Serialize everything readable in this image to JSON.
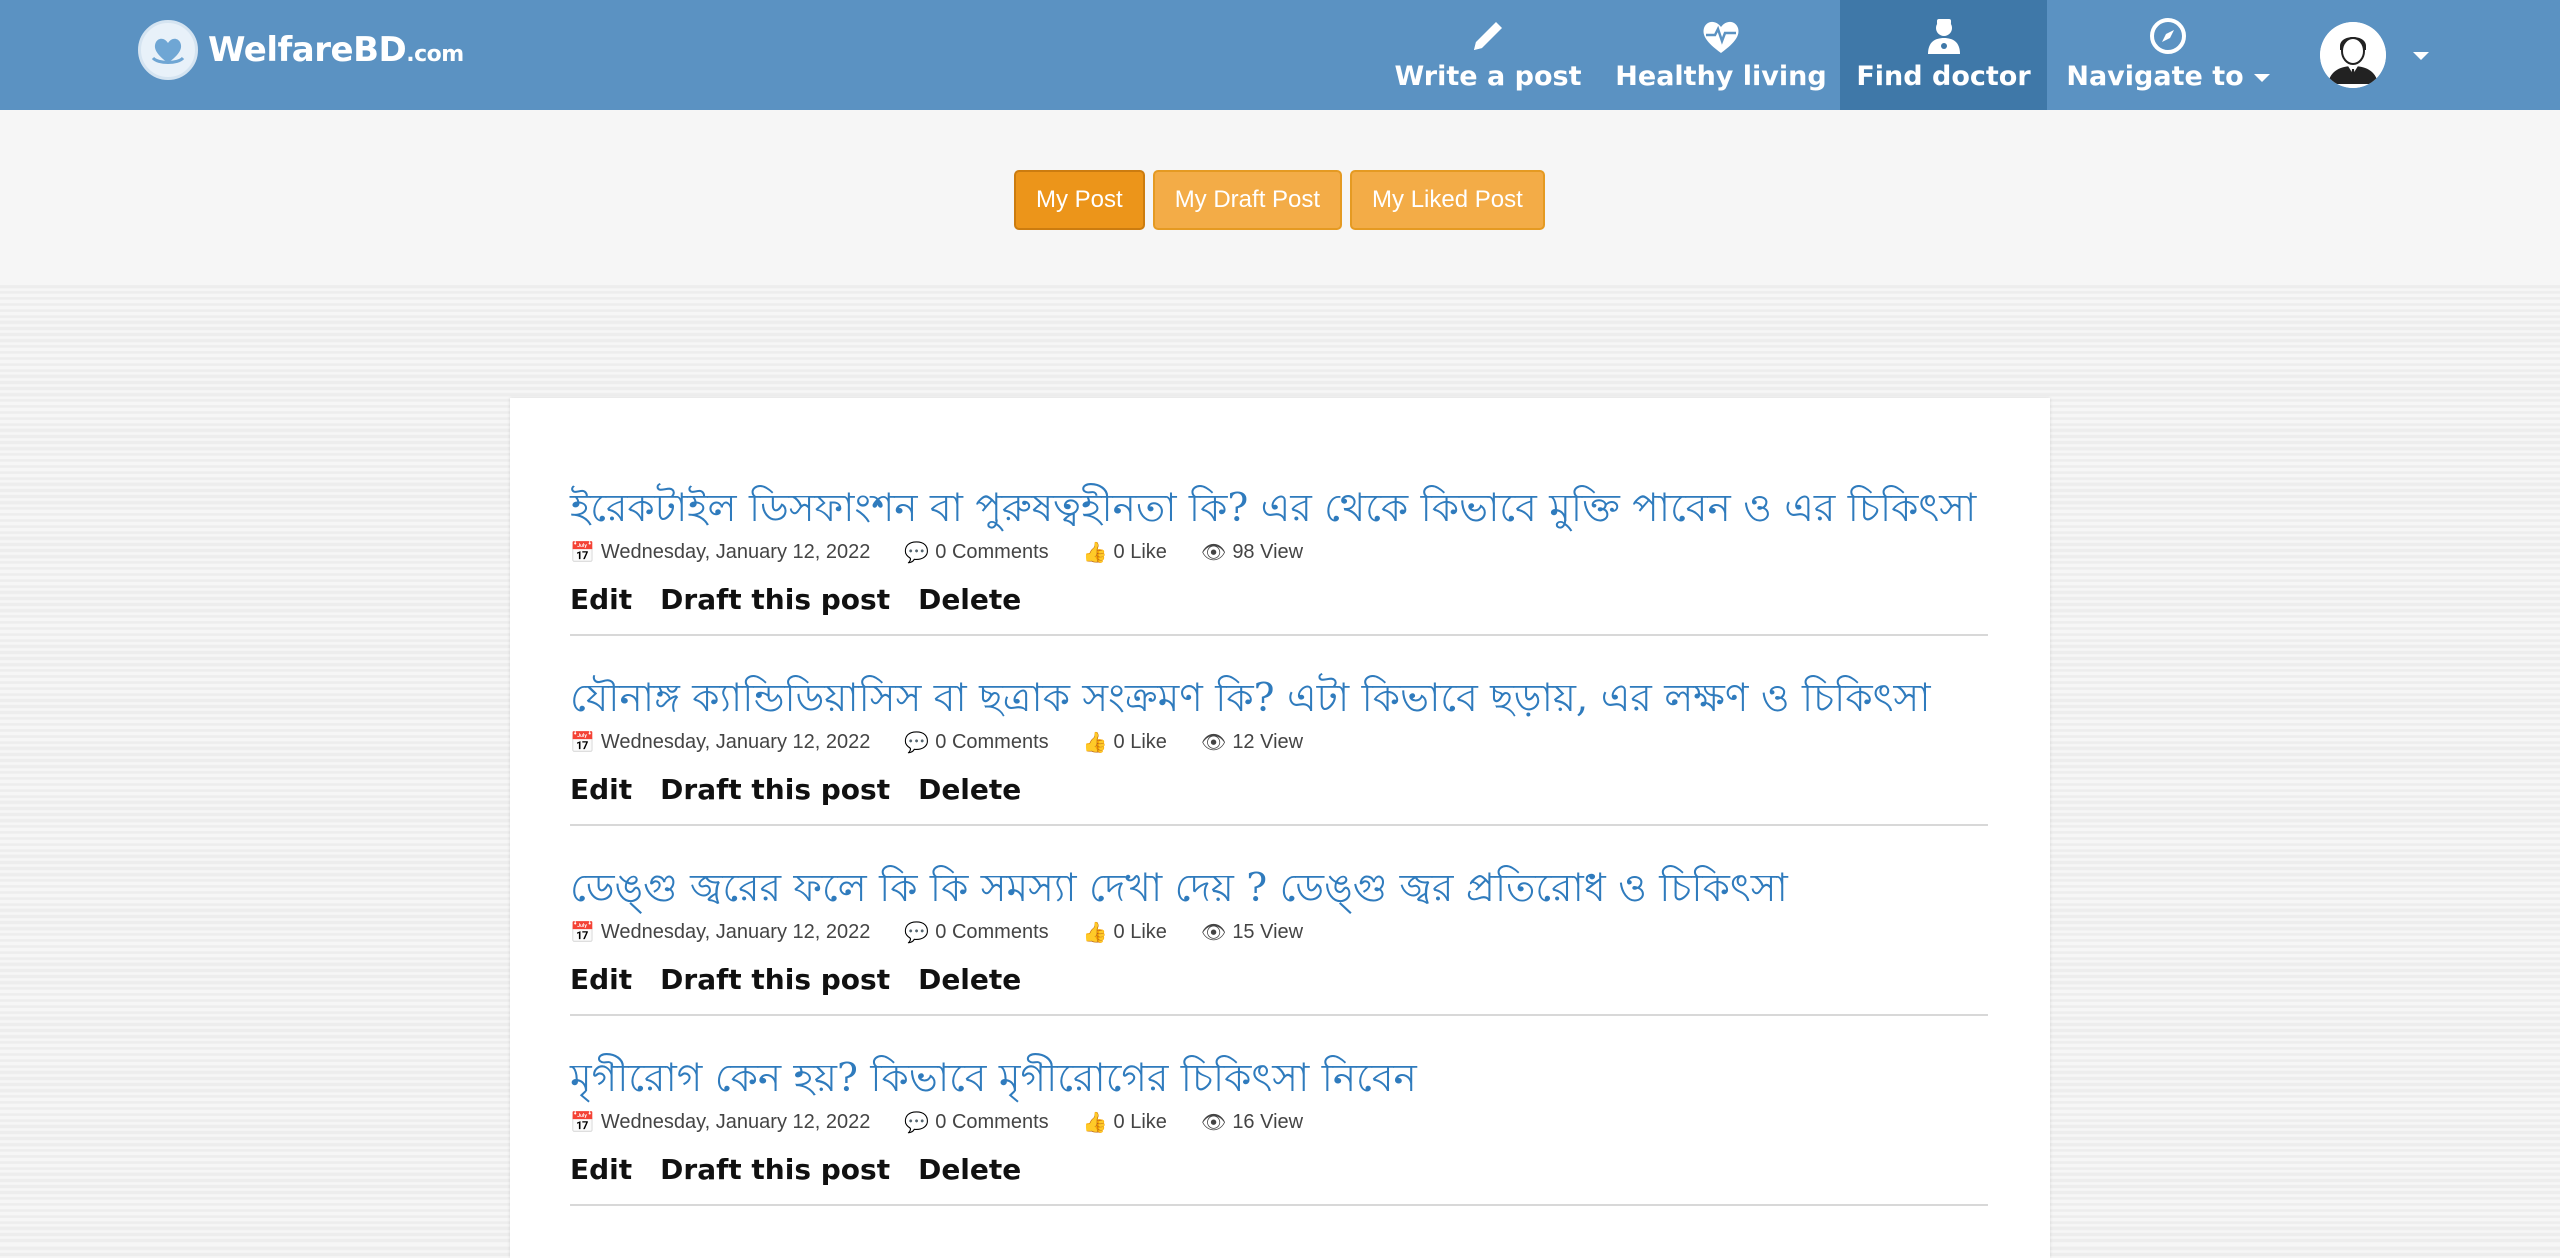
{
  "brand": {
    "name": "WelfareBD",
    "suffix": ".com"
  },
  "nav": {
    "write_post": "Write a post",
    "healthy_living": "Healthy living",
    "find_doctor": "Find doctor",
    "navigate_to": "Navigate to"
  },
  "tabs": {
    "my_post": "My Post",
    "my_draft_post": "My Draft Post",
    "my_liked_post": "My Liked Post"
  },
  "actions": {
    "edit": "Edit",
    "draft": "Draft this post",
    "delete": "Delete"
  },
  "posts": [
    {
      "title": "ইরেকটাইল ডিসফাংশন বা পুরুষত্বহীনতা কি? এর থেকে কিভাবে মুক্তি পাবেন ও এর চিকিৎসা",
      "date": "Wednesday, January 12, 2022",
      "comments": "0 Comments",
      "likes": "0 Like",
      "views": "98 View"
    },
    {
      "title": "যৌনাঙ্গ ক্যান্ডিডিয়াসিস বা ছত্রাক সংক্রমণ কি? এটা কিভাবে ছড়ায়, এর লক্ষণ ও চিকিৎসা",
      "date": "Wednesday, January 12, 2022",
      "comments": "0 Comments",
      "likes": "0 Like",
      "views": "12 View"
    },
    {
      "title": "ডেঙ্গু জ্বরের ফলে কি কি সমস্যা দেখা দেয় ? ডেঙ্গু জ্বর প্রতিরোধ ও চিকিৎসা",
      "date": "Wednesday, January 12, 2022",
      "comments": "0 Comments",
      "likes": "0 Like",
      "views": "15 View"
    },
    {
      "title": "মৃগীরোগ কেন হয়? কিভাবে মৃগীরোগের চিকিৎসা নিবেন",
      "date": "Wednesday, January 12, 2022",
      "comments": "0 Comments",
      "likes": "0 Like",
      "views": "16 View"
    }
  ],
  "colors": {
    "navbar": "#5b92c2",
    "nav_active": "#3f78a8",
    "tab_orange": "#f3ac47",
    "title_blue": "#2f7bbd"
  }
}
